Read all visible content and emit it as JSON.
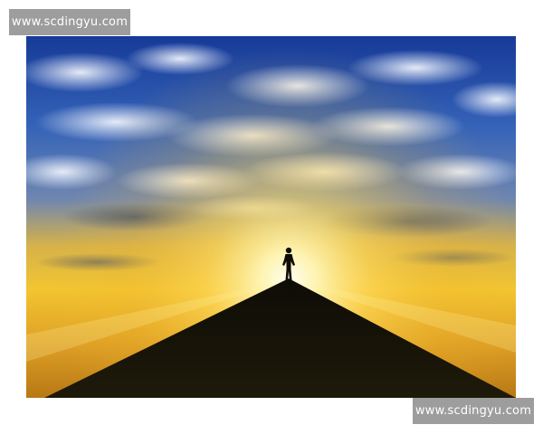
{
  "watermarks": {
    "top_text": "www.scdingyu.com",
    "bottom_text": "www.scdingyu.com"
  },
  "photo": {
    "subject": "silhouette-on-mountain-peak",
    "colors": {
      "sky_top": "#1b3f9e",
      "sky_mid": "#4c77c8",
      "horizon_glow": "#ffe27a",
      "sun_core": "#fffbe0",
      "lower_sky": "#d89a1f",
      "mountain": "#1a1608"
    }
  }
}
